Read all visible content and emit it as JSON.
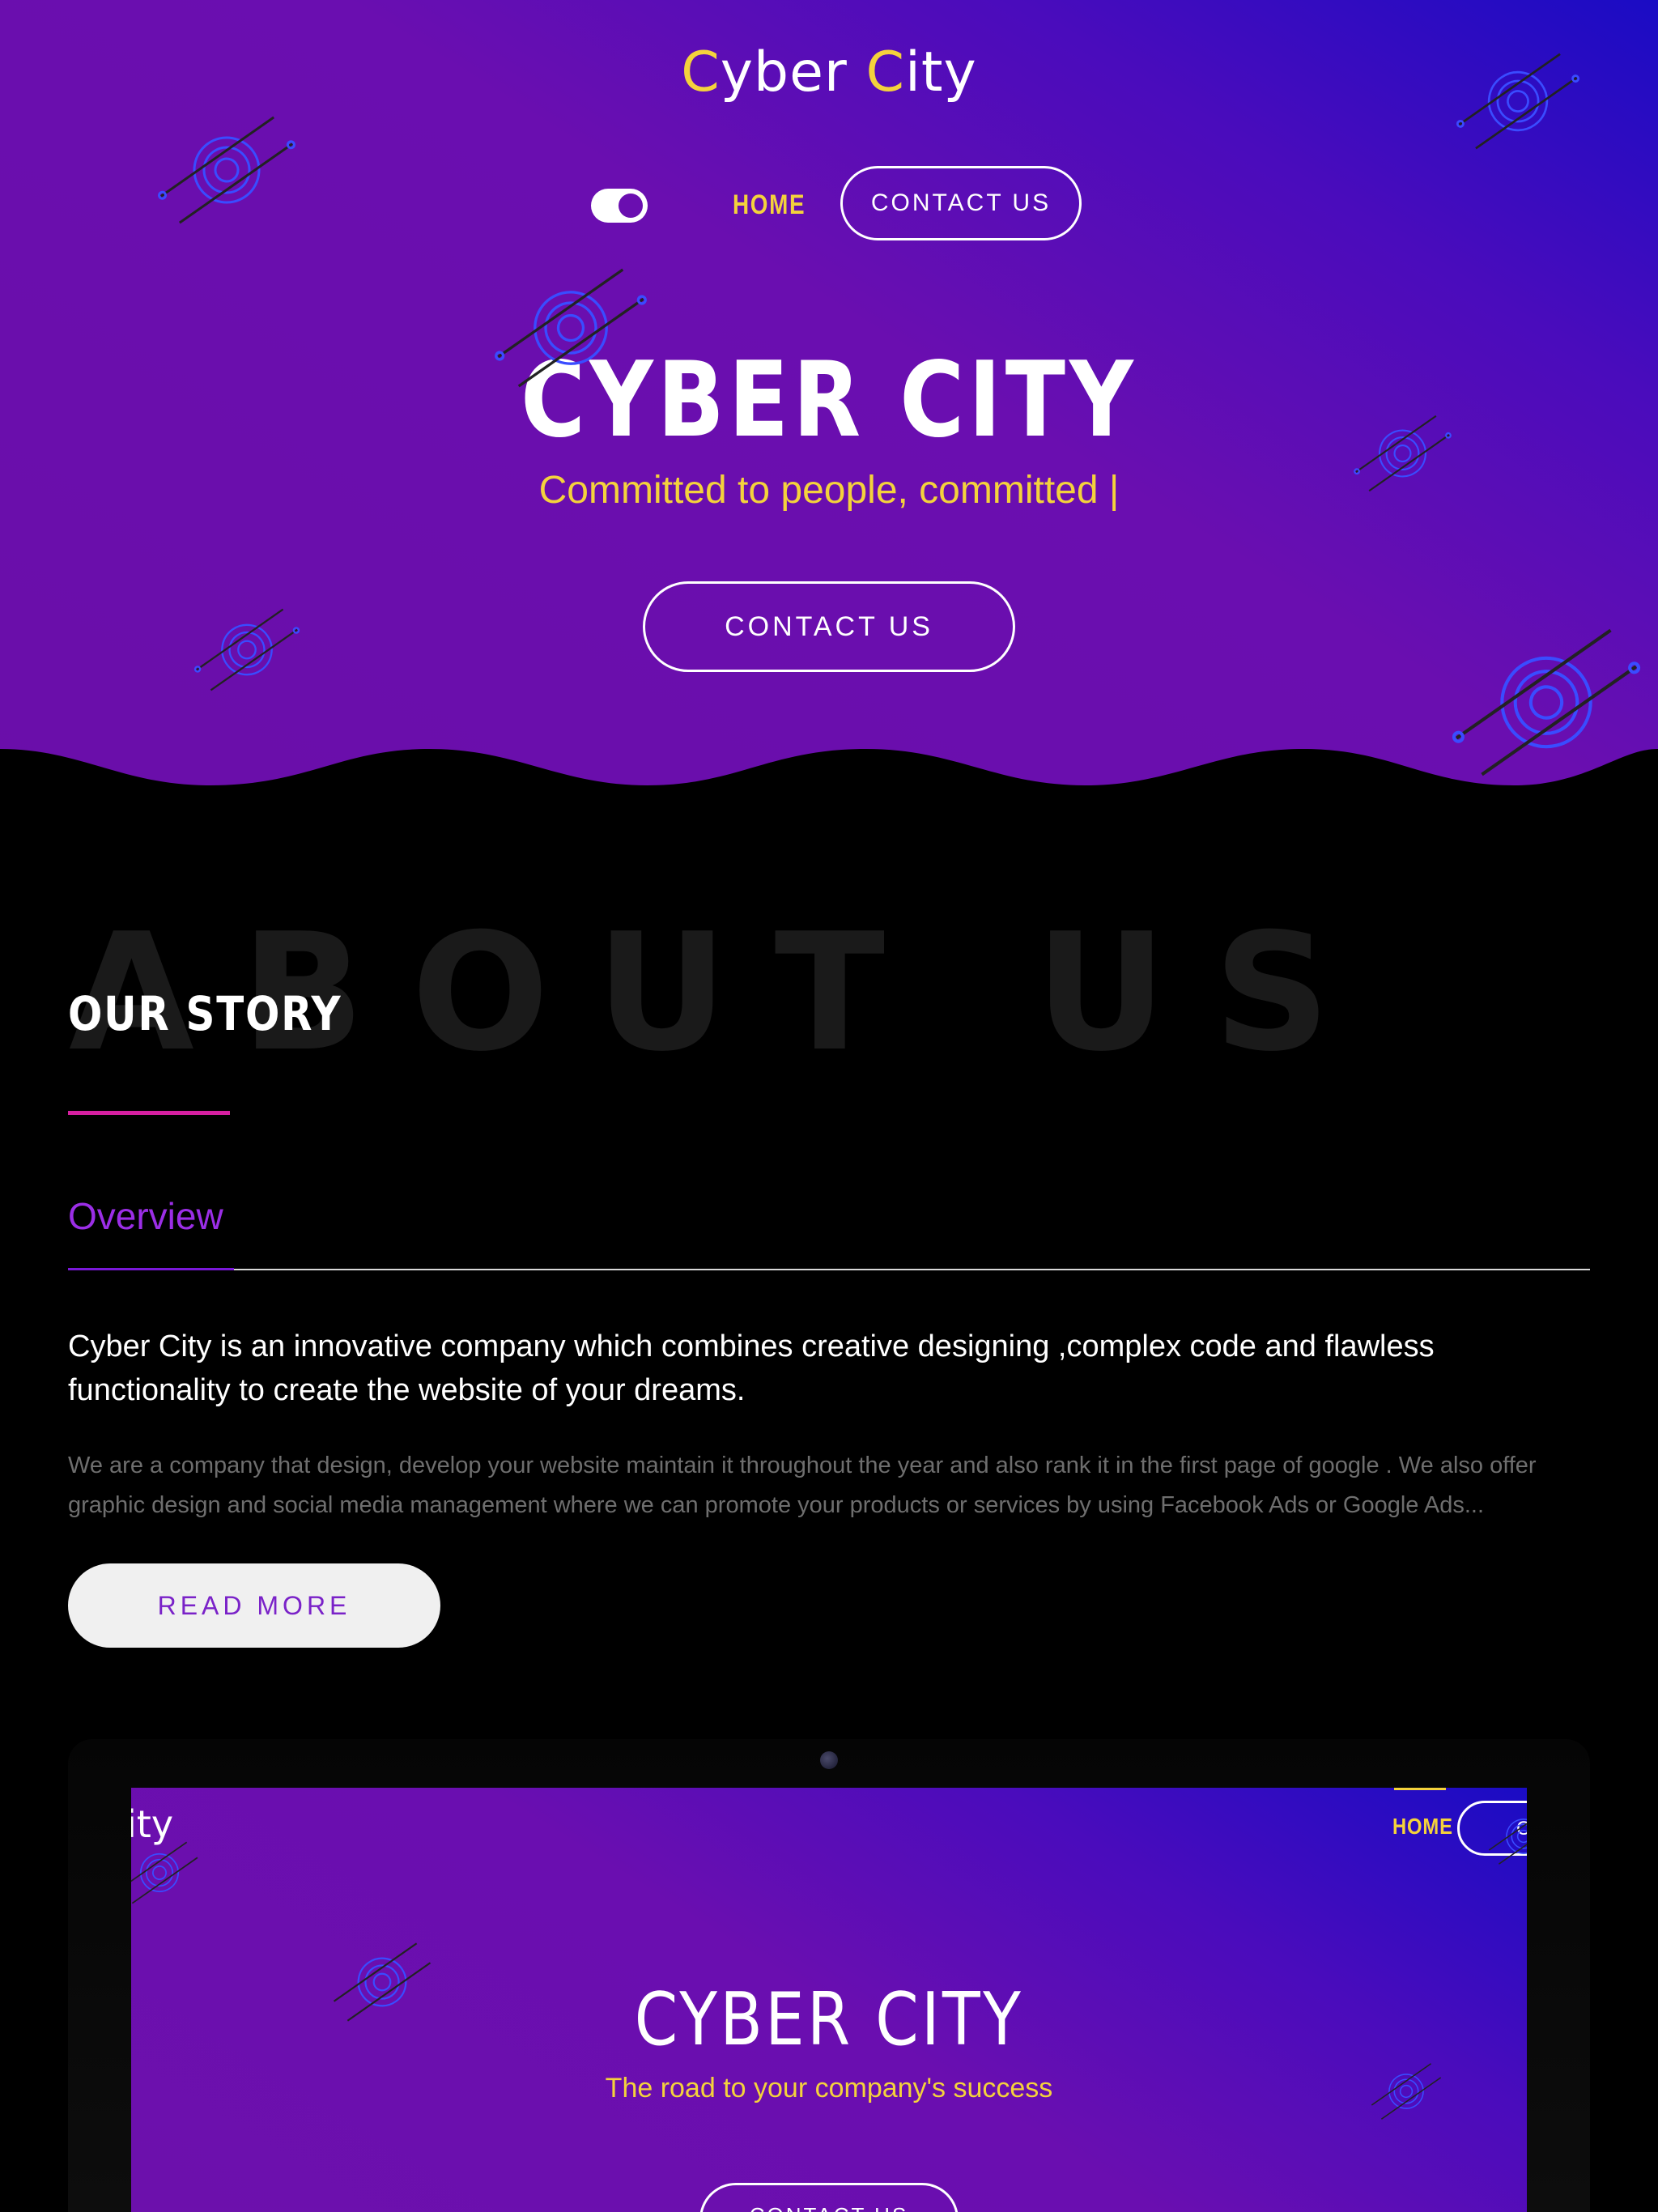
{
  "header": {
    "logo_text_c1": "C",
    "logo_text_r1": "yber ",
    "logo_text_c2": "C",
    "logo_text_r2": "ity",
    "nav_home": "HOME",
    "nav_contact": "CONTACT US"
  },
  "hero": {
    "title": "CYBER CITY",
    "subtitle": "Committed to people, committed |",
    "cta": "CONTACT US"
  },
  "about": {
    "background_word": "ABOUT US",
    "heading": "OUR STORY",
    "tab": "Overview",
    "lead": "Cyber City is an innovative company which combines creative designing ,complex code and flawless functionality to create the website of your dreams.",
    "body": "We are a company that design, develop your website maintain it throughout the year and also rank it in the first page of google . We also offer graphic design and social media management where we can promote your products or services by using Facebook Ads or Google Ads...",
    "read_more": "READ MORE"
  },
  "mockup": {
    "logo_fragment": "ity",
    "nav_home": "HOME",
    "nav_contact_fragment": "C",
    "title": "CYBER CITY",
    "subtitle": "The road to your company's success",
    "cta": "CONTACT US"
  },
  "colors": {
    "accent_yellow": "#f4d23c",
    "accent_purple": "#9b2ee6",
    "accent_pink": "#d61fa1",
    "hero_purple": "#6a0eb0",
    "hero_blue": "#1a0cc4"
  }
}
